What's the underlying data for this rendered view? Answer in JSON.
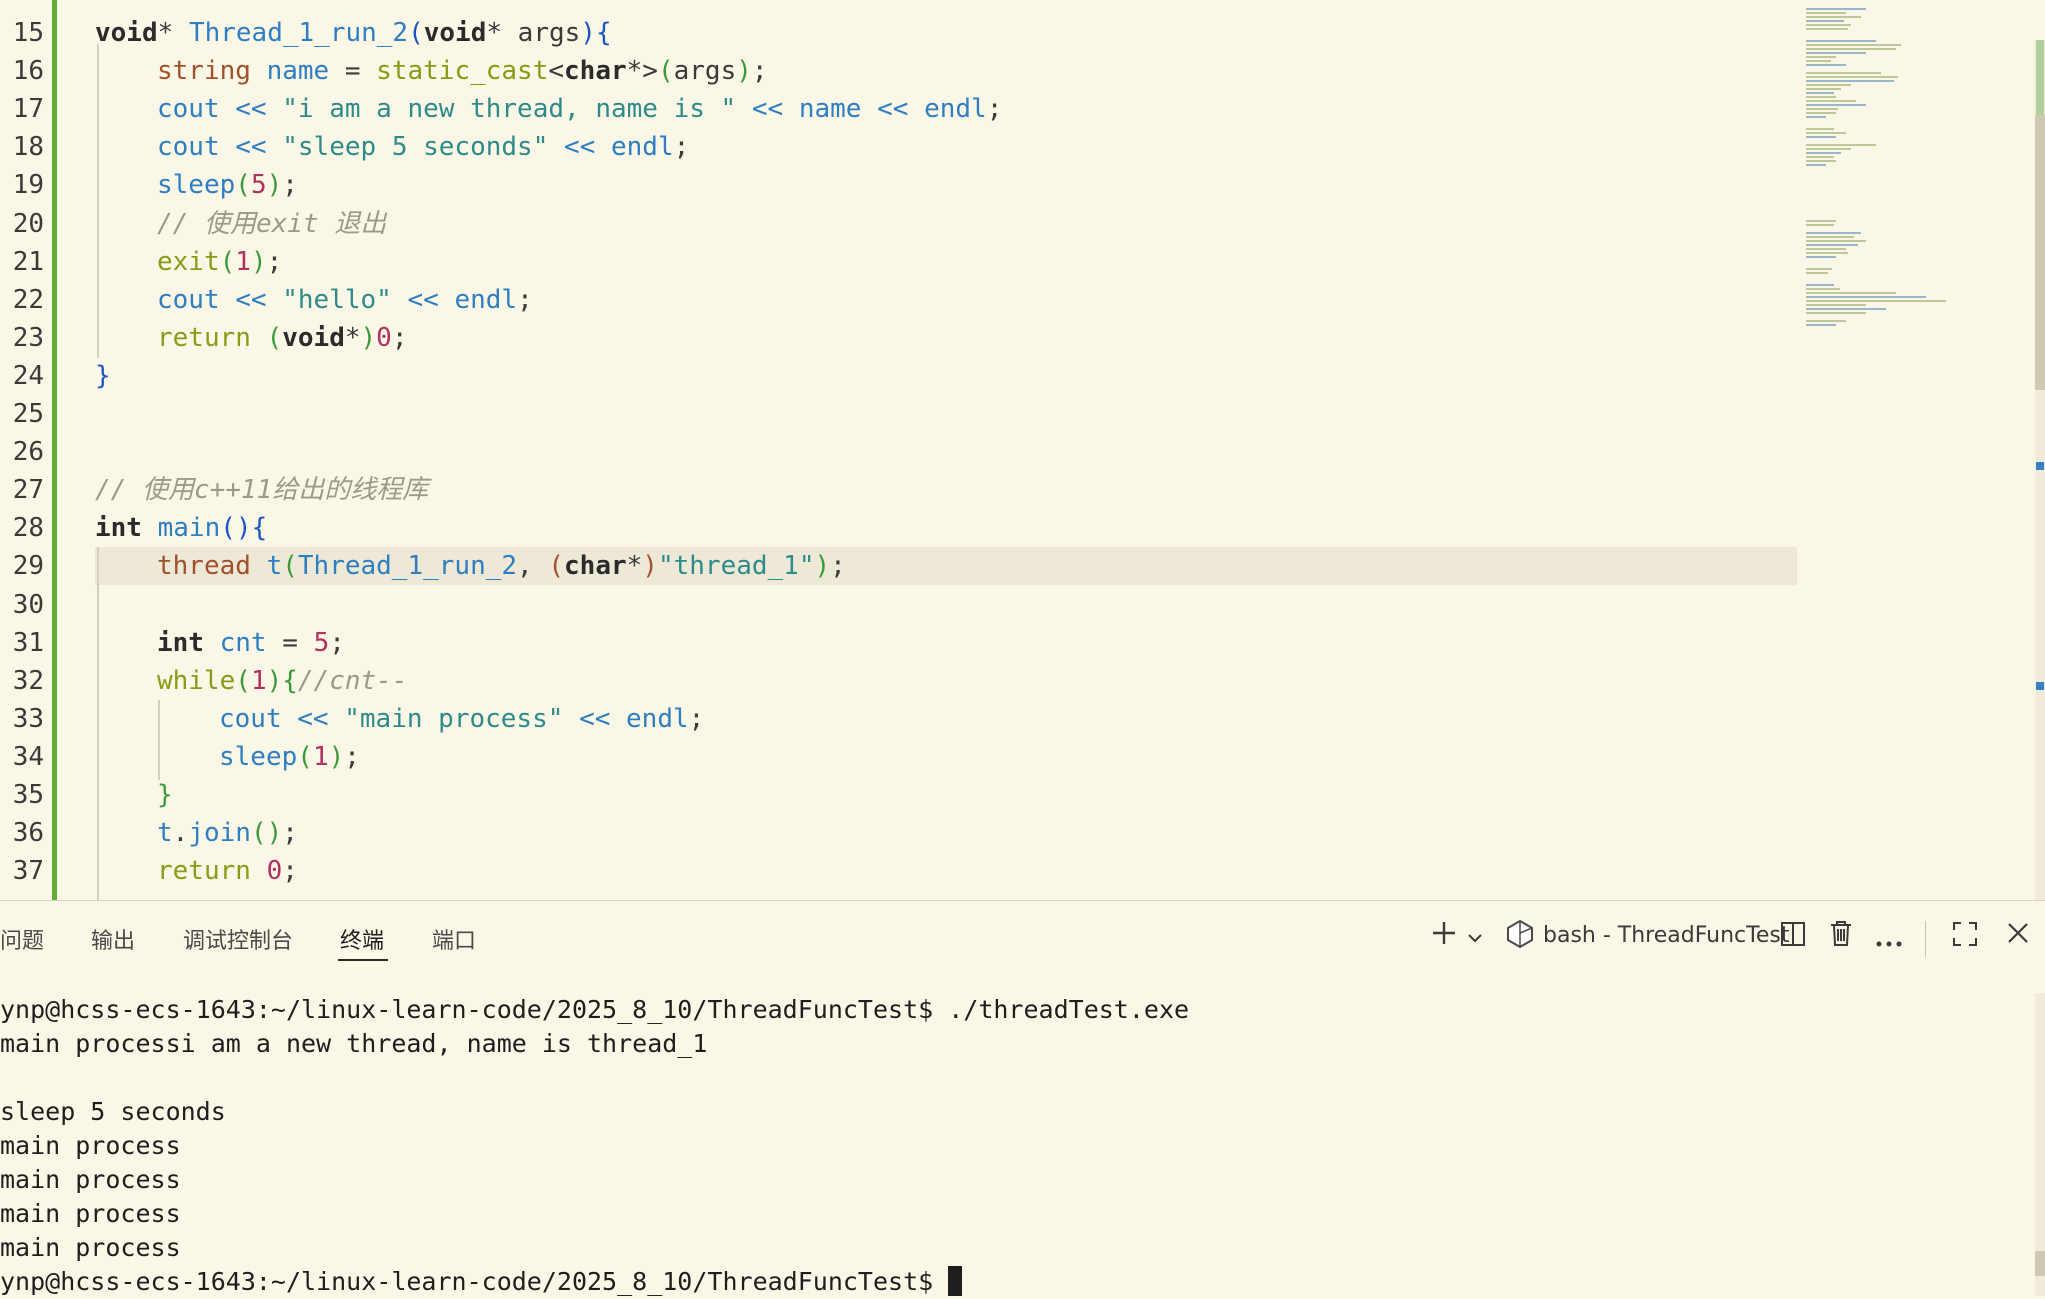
{
  "editor": {
    "lines": [
      {
        "n": "15",
        "tokens": [
          [
            "kw",
            "void"
          ],
          [
            "punc",
            "* "
          ],
          [
            "fn",
            "Thread_1_run_2"
          ],
          [
            "brace",
            "("
          ],
          [
            "kw",
            "void"
          ],
          [
            "punc",
            "* args"
          ],
          [
            "brace",
            ")"
          ],
          [
            "brace",
            "{"
          ]
        ]
      },
      {
        "n": "16",
        "tokens": [
          [
            "type",
            "string"
          ],
          [
            "punc",
            " "
          ],
          [
            "var",
            "name"
          ],
          [
            "punc",
            " = "
          ],
          [
            "ctl",
            "static_cast"
          ],
          [
            "punc",
            "<"
          ],
          [
            "kw",
            "char"
          ],
          [
            "punc",
            "*>"
          ],
          [
            "brace2",
            "("
          ],
          [
            "punc",
            "args"
          ],
          [
            "brace2",
            ")"
          ],
          [
            "punc",
            ";"
          ]
        ]
      },
      {
        "n": "17",
        "tokens": [
          [
            "fn",
            "cout"
          ],
          [
            "punc",
            " "
          ],
          [
            "op",
            "<<"
          ],
          [
            "punc",
            " "
          ],
          [
            "str",
            "\"i am a new thread, name is \""
          ],
          [
            "punc",
            " "
          ],
          [
            "op",
            "<<"
          ],
          [
            "punc",
            " "
          ],
          [
            "var",
            "name"
          ],
          [
            "punc",
            " "
          ],
          [
            "op",
            "<<"
          ],
          [
            "punc",
            " "
          ],
          [
            "fn",
            "endl"
          ],
          [
            "punc",
            ";"
          ]
        ]
      },
      {
        "n": "18",
        "tokens": [
          [
            "fn",
            "cout"
          ],
          [
            "punc",
            " "
          ],
          [
            "op",
            "<<"
          ],
          [
            "punc",
            " "
          ],
          [
            "str",
            "\"sleep 5 seconds\""
          ],
          [
            "punc",
            " "
          ],
          [
            "op",
            "<<"
          ],
          [
            "punc",
            " "
          ],
          [
            "fn",
            "endl"
          ],
          [
            "punc",
            ";"
          ]
        ]
      },
      {
        "n": "19",
        "tokens": [
          [
            "fn",
            "sleep"
          ],
          [
            "brace2",
            "("
          ],
          [
            "num",
            "5"
          ],
          [
            "brace2",
            ")"
          ],
          [
            "punc",
            ";"
          ]
        ]
      },
      {
        "n": "20",
        "tokens": [
          [
            "cmt",
            "// 使用exit 退出"
          ]
        ]
      },
      {
        "n": "21",
        "tokens": [
          [
            "ctl",
            "exit"
          ],
          [
            "brace2",
            "("
          ],
          [
            "num",
            "1"
          ],
          [
            "brace2",
            ")"
          ],
          [
            "punc",
            ";"
          ]
        ]
      },
      {
        "n": "22",
        "tokens": [
          [
            "fn",
            "cout"
          ],
          [
            "punc",
            " "
          ],
          [
            "op",
            "<<"
          ],
          [
            "punc",
            " "
          ],
          [
            "str",
            "\"hello\""
          ],
          [
            "punc",
            " "
          ],
          [
            "op",
            "<<"
          ],
          [
            "punc",
            " "
          ],
          [
            "fn",
            "endl"
          ],
          [
            "punc",
            ";"
          ]
        ]
      },
      {
        "n": "23",
        "tokens": [
          [
            "ctl",
            "return"
          ],
          [
            "punc",
            " "
          ],
          [
            "brace2",
            "("
          ],
          [
            "kw",
            "void"
          ],
          [
            "punc",
            "*"
          ],
          [
            "brace2",
            ")"
          ],
          [
            "num",
            "0"
          ],
          [
            "punc",
            ";"
          ]
        ]
      },
      {
        "n": "24",
        "tokens": [
          [
            "brace",
            "}"
          ]
        ]
      },
      {
        "n": "25",
        "tokens": []
      },
      {
        "n": "26",
        "tokens": []
      },
      {
        "n": "27",
        "tokens": [
          [
            "cmt",
            "// 使用c++11给出的线程库"
          ]
        ]
      },
      {
        "n": "28",
        "tokens": [
          [
            "kw",
            "int"
          ],
          [
            "punc",
            " "
          ],
          [
            "fn",
            "main"
          ],
          [
            "brace",
            "("
          ],
          [
            "brace",
            ")"
          ],
          [
            "brace",
            "{"
          ]
        ]
      },
      {
        "n": "29",
        "tokens": [
          [
            "type",
            "thread"
          ],
          [
            "punc",
            " "
          ],
          [
            "fn",
            "t"
          ],
          [
            "brace2",
            "("
          ],
          [
            "fn",
            "Thread_1_run_2"
          ],
          [
            "punc",
            ", "
          ],
          [
            "type",
            "("
          ],
          [
            "kw",
            "char"
          ],
          [
            "punc",
            "*"
          ],
          [
            "type",
            ")"
          ],
          [
            "str",
            "\"thread_1\""
          ],
          [
            "brace2",
            ")"
          ],
          [
            "punc",
            ";"
          ]
        ]
      },
      {
        "n": "30",
        "tokens": []
      },
      {
        "n": "31",
        "tokens": [
          [
            "kw",
            "int"
          ],
          [
            "punc",
            " "
          ],
          [
            "var",
            "cnt"
          ],
          [
            "punc",
            " = "
          ],
          [
            "num",
            "5"
          ],
          [
            "punc",
            ";"
          ]
        ]
      },
      {
        "n": "32",
        "tokens": [
          [
            "ctl",
            "while"
          ],
          [
            "brace2",
            "("
          ],
          [
            "num",
            "1"
          ],
          [
            "brace2",
            ")"
          ],
          [
            "brace2",
            "{"
          ],
          [
            "cmt",
            "//cnt--"
          ]
        ]
      },
      {
        "n": "33",
        "tokens": [
          [
            "fn",
            "cout"
          ],
          [
            "punc",
            " "
          ],
          [
            "op",
            "<<"
          ],
          [
            "punc",
            " "
          ],
          [
            "str",
            "\"main process\""
          ],
          [
            "punc",
            " "
          ],
          [
            "op",
            "<<"
          ],
          [
            "punc",
            " "
          ],
          [
            "fn",
            "endl"
          ],
          [
            "punc",
            ";"
          ]
        ]
      },
      {
        "n": "34",
        "tokens": [
          [
            "fn",
            "sleep"
          ],
          [
            "brace2",
            "("
          ],
          [
            "num",
            "1"
          ],
          [
            "brace2",
            ")"
          ],
          [
            "punc",
            ";"
          ]
        ]
      },
      {
        "n": "35",
        "tokens": [
          [
            "brace2",
            "}"
          ]
        ]
      },
      {
        "n": "36",
        "tokens": [
          [
            "fn",
            "t"
          ],
          [
            "punc",
            "."
          ],
          [
            "fn",
            "join"
          ],
          [
            "brace2",
            "("
          ],
          [
            "brace2",
            ")"
          ],
          [
            "punc",
            ";"
          ]
        ]
      },
      {
        "n": "37",
        "tokens": [
          [
            "ctl",
            "return"
          ],
          [
            "punc",
            " "
          ],
          [
            "num",
            "0"
          ],
          [
            "punc",
            ";"
          ]
        ]
      }
    ]
  },
  "panel": {
    "tabs": [
      {
        "label": "问题"
      },
      {
        "label": "输出"
      },
      {
        "label": "调试控制台"
      },
      {
        "label": "终端",
        "active": true
      },
      {
        "label": "端口"
      }
    ],
    "terminal_title": "bash - ThreadFuncTest",
    "icons": {
      "add": "plus-icon",
      "dropdown": "chevron-down-icon",
      "split": "split-icon",
      "trash": "trash-icon",
      "more": "ellipsis-icon",
      "maximize": "maximize-icon",
      "close": "close-icon"
    }
  },
  "terminal": {
    "lines": [
      "ynp@hcss-ecs-1643:~/linux-learn-code/2025_8_10/ThreadFuncTest$ ./threadTest.exe",
      "main processi am a new thread, name is thread_1",
      "",
      "sleep 5 seconds",
      "main process",
      "main process",
      "main process",
      "main process"
    ],
    "prompt": "ynp@hcss-ecs-1643:~/linux-learn-code/2025_8_10/ThreadFuncTest$ "
  },
  "colors": {
    "background": "#fbf7e6",
    "git_added": "#5fae3b",
    "current_line": "#eee8d6"
  }
}
